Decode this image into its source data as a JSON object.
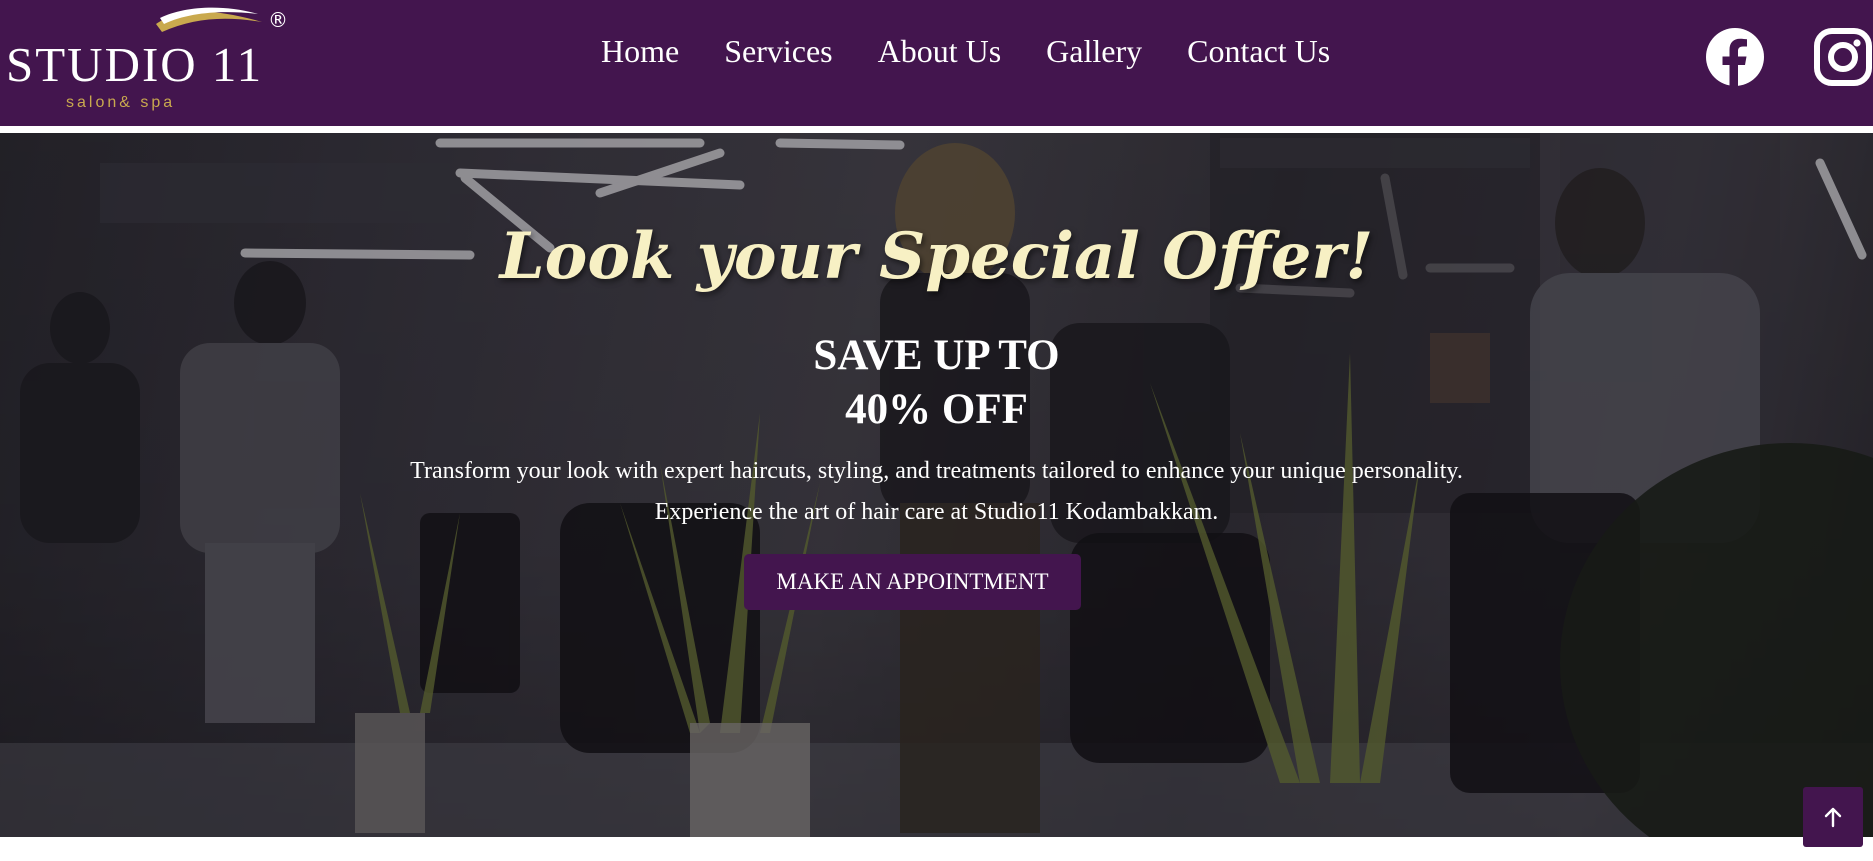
{
  "brand": {
    "name": "STUDIO 11",
    "tagline": "salon& spa",
    "registered_mark": "®",
    "colors": {
      "primary": "#43154e",
      "accent_gold": "#c9a94e",
      "title_cream": "#f7f0c4"
    }
  },
  "nav": {
    "items": [
      {
        "label": "Home"
      },
      {
        "label": "Services"
      },
      {
        "label": "About Us"
      },
      {
        "label": "Gallery"
      },
      {
        "label": "Contact Us"
      }
    ]
  },
  "social": [
    {
      "icon": "facebook-icon"
    },
    {
      "icon": "instagram-icon"
    }
  ],
  "hero": {
    "title": "Look your Special Offer!",
    "heading_line1": "SAVE UP TO",
    "heading_line2": "40% OFF",
    "text_line1": "Transform your look with expert haircuts, styling, and treatments tailored to enhance your unique personality.",
    "text_line2": "Experience the art of  hair care at Studio11 Kodambakkam.",
    "cta_label": "MAKE AN APPOINTMENT"
  },
  "scroll_top": {
    "icon": "arrow-up-icon"
  }
}
